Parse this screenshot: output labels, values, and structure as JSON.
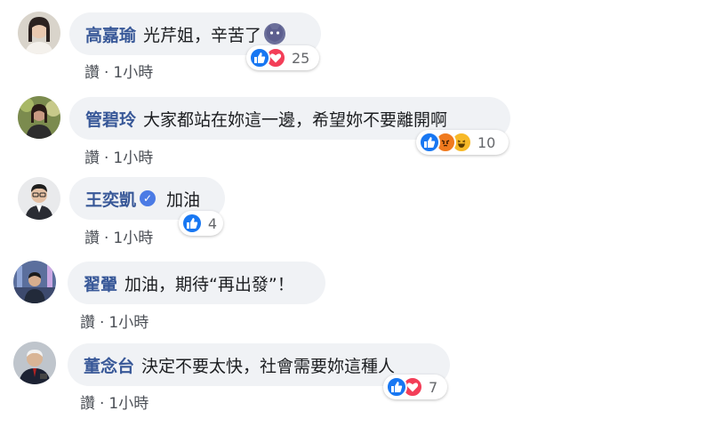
{
  "action_label": "讚",
  "separator": "·",
  "colors": {
    "author": "#385898",
    "bubble": "#f0f2f5",
    "like": "#1877f2",
    "love": "#f33e58",
    "angry": "#f07a1e",
    "haha": "#f7b928"
  },
  "comments": [
    {
      "author": "高嘉瑜",
      "text": "光芹姐，辛苦了",
      "emoji": "purple-cat-emoji",
      "time": "1小時",
      "reactions": [
        "like-icon",
        "love-icon"
      ],
      "reaction_count": "25"
    },
    {
      "author": "管碧玲",
      "text": "大家都站在妳這一邊，希望妳不要離開啊",
      "time": "1小時",
      "reactions": [
        "like-icon",
        "angry-icon",
        "haha-icon"
      ],
      "reaction_count": "10"
    },
    {
      "author": "王奕凱",
      "verified": true,
      "text": "加油",
      "time": "1小時",
      "reactions": [
        "like-icon"
      ],
      "reaction_count": "4"
    },
    {
      "author": "翟翬",
      "text": "加油，期待“再出發”！",
      "time": "1小時",
      "reactions": [],
      "reaction_count": ""
    },
    {
      "author": "董念台",
      "text": "決定不要太快，社會需要妳這種人",
      "time": "1小時",
      "reactions": [
        "like-icon",
        "love-icon"
      ],
      "reaction_count": "7"
    }
  ]
}
